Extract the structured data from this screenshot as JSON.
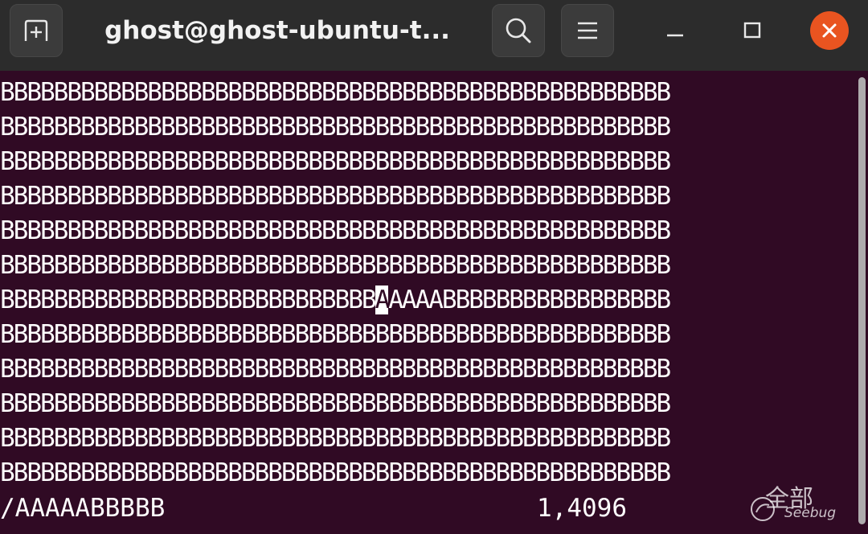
{
  "window": {
    "title": "ghost@ghost-ubuntu-t...",
    "icons": {
      "new_tab": "new-tab-icon",
      "search": "search-icon",
      "menu": "hamburger-menu-icon",
      "minimize": "minimize-icon",
      "maximize": "maximize-icon",
      "close": "close-icon"
    },
    "colors": {
      "titlebar": "#2c2c2c",
      "terminal_bg": "#300a24",
      "close_button": "#e95420",
      "text": "#ffffff"
    }
  },
  "terminal": {
    "lines": [
      "BBBBBBBBBBBBBBBBBBBBBBBBBBBBBBBBBBBBBBBBBBBBBBBBBB",
      "BBBBBBBBBBBBBBBBBBBBBBBBBBBBBBBBBBBBBBBBBBBBBBBBBB",
      "BBBBBBBBBBBBBBBBBBBBBBBBBBBBBBBBBBBBBBBBBBBBBBBBBB",
      "BBBBBBBBBBBBBBBBBBBBBBBBBBBBBBBBBBBBBBBBBBBBBBBBBB",
      "BBBBBBBBBBBBBBBBBBBBBBBBBBBBBBBBBBBBBBBBBBBBBBBBBB",
      "BBBBBBBBBBBBBBBBBBBBBBBBBBBBBBBBBBBBBBBBBBBBBBBBBB",
      "",
      "BBBBBBBBBBBBBBBBBBBBBBBBBBBBBBBBBBBBBBBBBBBBBBBBBB",
      "BBBBBBBBBBBBBBBBBBBBBBBBBBBBBBBBBBBBBBBBBBBBBBBBBB",
      "BBBBBBBBBBBBBBBBBBBBBBBBBBBBBBBBBBBBBBBBBBBBBBBBBB",
      "BBBBBBBBBBBBBBBBBBBBBBBBBBBBBBBBBBBBBBBBBBBBBBBBBB",
      "BBBBBBBBBBBBBBBBBBBBBBBBBBBBBBBBBBBBBBBBBBBBBBBBBB"
    ],
    "match_line": {
      "before": "BBBBBBBBBBBBBBBBBBBBBBBBBBBB",
      "cursor_char": "A",
      "after": "AAAABBBBBBBBBBBBBBBBB"
    },
    "status": {
      "search": "/AAAAABBBBB",
      "position": "1,4096"
    }
  },
  "watermark": {
    "chinese": "全部",
    "brand": "Seebug"
  }
}
